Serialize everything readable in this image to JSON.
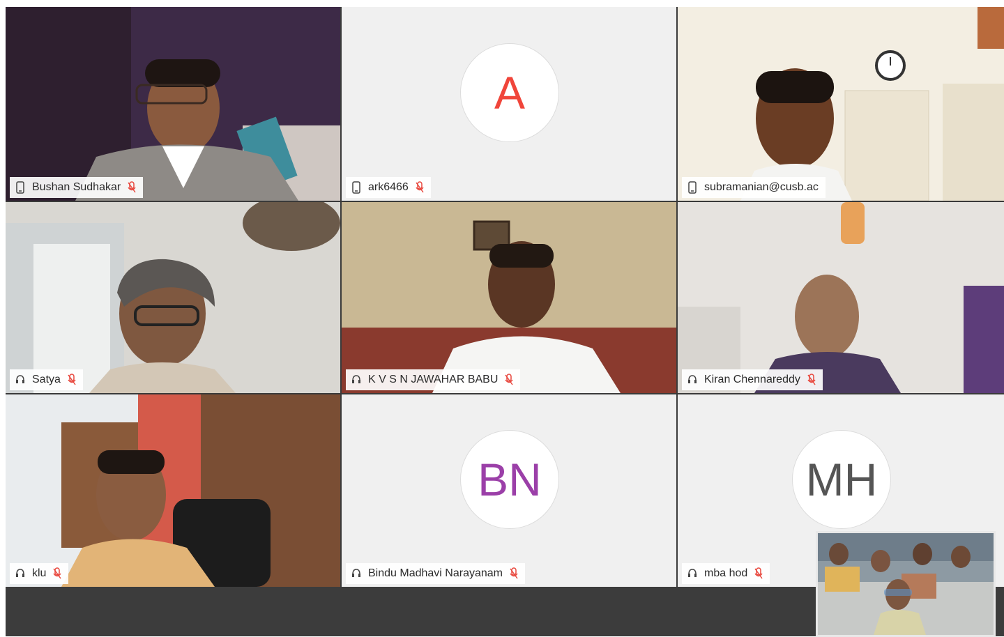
{
  "participants": [
    {
      "name": "Bushan Sudhakar",
      "kind": "video",
      "device": "phone"
    },
    {
      "name": "ark6466",
      "kind": "avatar",
      "initials": "A",
      "initials_color": "#f0453a",
      "device": "phone"
    },
    {
      "name": "subramanian@cusb.ac",
      "kind": "video",
      "device": "phone"
    },
    {
      "name": "Satya",
      "kind": "video",
      "device": "headset"
    },
    {
      "name": "K V S N JAWAHAR BABU",
      "kind": "video",
      "device": "headset"
    },
    {
      "name": "Kiran Chennareddy",
      "kind": "video",
      "device": "headset"
    },
    {
      "name": "klu",
      "kind": "video",
      "device": "headset"
    },
    {
      "name": "Bindu Madhavi Narayanam",
      "kind": "avatar",
      "initials": "BN",
      "initials_color": "#9b3fa8",
      "device": "headset"
    },
    {
      "name": "mba hod",
      "kind": "avatar",
      "initials": "MH",
      "initials_color": "#555555",
      "device": "headset"
    }
  ],
  "colors": {
    "muted_mic": "#e8473d",
    "tile_bg": "#f0f0f0",
    "bottom_bar": "#3c3c3c"
  }
}
